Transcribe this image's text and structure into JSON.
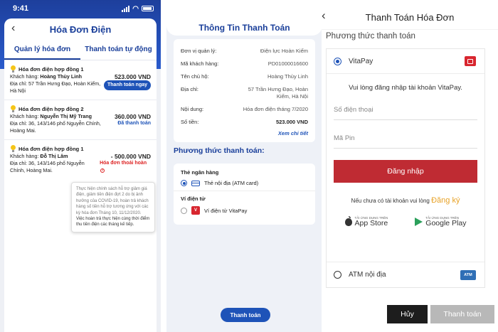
{
  "panel1": {
    "status_time": "9:41",
    "title": "Hóa Đơn Điện",
    "tabs": [
      "Quản lý hóa đơn",
      "Thanh toán tự động"
    ],
    "bills": [
      {
        "title": "Hóa đơn điện hợp đồng 1",
        "customer_label": "Khách hàng:",
        "customer": "Hoàng Thùy Linh",
        "amount": "523.000 VND",
        "address_label": "Địa chỉ:",
        "address": "57 Trần Hưng Đạo, Hoàn Kiếm, Hà Nội",
        "action": "Thanh toán ngay"
      },
      {
        "title": "Hóa đơn điện hợp đồng 2",
        "customer_label": "Khách hàng:",
        "customer": "Nguyễn Thị Mỹ Trang",
        "amount": "360.000 VND",
        "address_label": "Địa chỉ:",
        "address": "36, 143/146 phố Nguyễn Chính, Hoàng Mai.",
        "action": "Đã thanh toán"
      },
      {
        "title": "Hóa đơn điện hợp đồng 1",
        "customer_label": "Khách hàng:",
        "customer": "Đỗ Thị Lâm",
        "amount": "- 500.000 VND",
        "address_label": "Địa chỉ:",
        "address": "36, 143/146 phố Nguyễn Chính, Hoàng Mai.",
        "action": "Hóa đơn thoái hoàn"
      }
    ],
    "tooltip_plain": "Thực hiện chính sách hỗ trợ giảm giá điện, giảm tiền điện đợt 2 do bị ảnh hưởng của COVID-19, hoàn trả khách hàng số tiền hỗ trợ tương ứng với các kỳ hóa đơn Tháng 10, 11/12/2020.",
    "tooltip_dark": "Việc hoàn trả thực hiện cùng thời điểm thu tiền điện các tháng kế tiếp."
  },
  "panel2": {
    "title": "Thông Tin Thanh Toán",
    "rows": [
      {
        "k": "Đơn vị quản lý:",
        "v": "Điện lực Hoàn Kiếm"
      },
      {
        "k": "Mã khách hàng:",
        "v": "PD01000016600"
      },
      {
        "k": "Tên chủ hộ:",
        "v": "Hoàng Thùy Linh"
      },
      {
        "k": "Địa chỉ:",
        "v": "57 Trần Hưng Đạo, Hoàn Kiếm, Hà Nội"
      },
      {
        "k": "Nội dung:",
        "v": "Hóa đơn điện tháng 7/2020"
      },
      {
        "k": "Số tiền:",
        "v": "523.000 VND"
      }
    ],
    "see_more": "Xem chi tiết",
    "section_title": "Phương thức thanh toán:",
    "group_bank": "Thẻ ngân hàng",
    "opt_atm": "Thẻ nội địa (ATM card)",
    "group_wallet": "Ví điện tử",
    "opt_wallet": "Ví điện tử VitaPay",
    "button": "Thanh toán"
  },
  "panel3": {
    "title": "Thanh Toán Hóa Đơn",
    "subtitle": "Phương thức thanh toán",
    "vitapay": "VitaPay",
    "message": "Vui lòng đăng nhập tài khoản VitaPay.",
    "phone_placeholder": "Số điện thoại",
    "pin_placeholder": "Mã Pin",
    "login": "Đăng nhập",
    "register_prompt": "Nếu chưa có tài khoản vui lòng",
    "register": "Đăng ký",
    "appstore_small": "TẢI ỨNG DỤNG TRÊN",
    "appstore": "App Store",
    "gplay_small": "TẢI ỨNG DỤNG TRÊN",
    "gplay": "Google Play",
    "atm": "ATM nội địa",
    "atm_badge": "ATM",
    "cancel": "Hủy",
    "pay": "Thanh toán"
  }
}
